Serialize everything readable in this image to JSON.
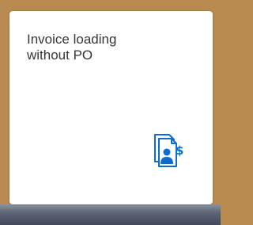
{
  "tile": {
    "title_line1": "Invoice loading",
    "title_line2": "without PO",
    "icon": "invoice-document-person-dollar-icon",
    "accent_color": "#0a6ed1"
  }
}
